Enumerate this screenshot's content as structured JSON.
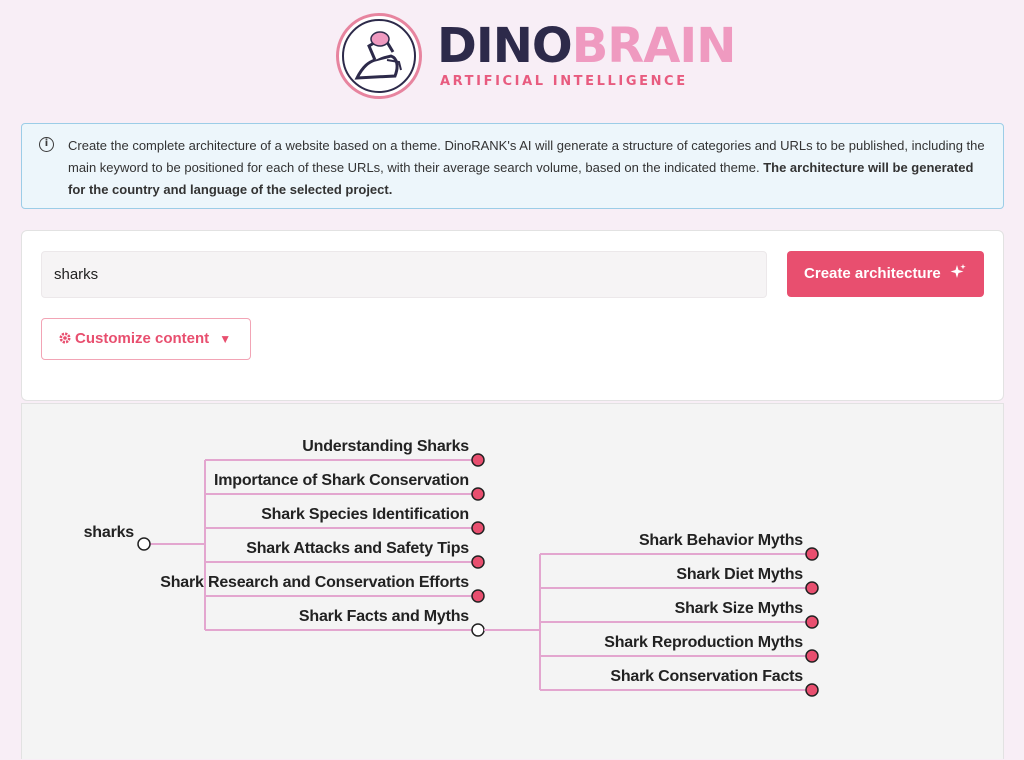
{
  "brand": {
    "name_part1": "DINO",
    "name_part2": "BRAIN",
    "subtitle": "ARTIFICIAL INTELLIGENCE",
    "colors": {
      "dark": "#2d2a4a",
      "pink": "#ef9ac0",
      "accent": "#e84f6f"
    }
  },
  "info": {
    "icon": "info-circle-icon",
    "text_normal": "Create the complete architecture of a website based on a theme. DinoRANK's AI will generate a structure of categories and URLs to be published, including the main keyword to be positioned for each of these URLs, with their average search volume, based on the indicated theme.",
    "text_bold": "The architecture will be generated for the country and language of the selected project."
  },
  "form": {
    "theme_value": "sharks",
    "create_label": "Create architecture",
    "create_icon": "sparkle-icon",
    "customize_label": "Customize content",
    "customize_icon": "gear-icon",
    "customize_chevron": "chevron-down-icon"
  },
  "tree": {
    "root": "sharks",
    "children": [
      {
        "label": "Understanding Sharks"
      },
      {
        "label": "Importance of Shark Conservation"
      },
      {
        "label": "Shark Species Identification"
      },
      {
        "label": "Shark Attacks and Safety Tips"
      },
      {
        "label": "Shark Research and Conservation Efforts"
      },
      {
        "label": "Shark Facts and Myths",
        "children": [
          {
            "label": "Shark Behavior Myths"
          },
          {
            "label": "Shark Diet Myths"
          },
          {
            "label": "Shark Size Myths"
          },
          {
            "label": "Shark Reproduction Myths"
          },
          {
            "label": "Shark Conservation Facts"
          }
        ]
      }
    ]
  }
}
